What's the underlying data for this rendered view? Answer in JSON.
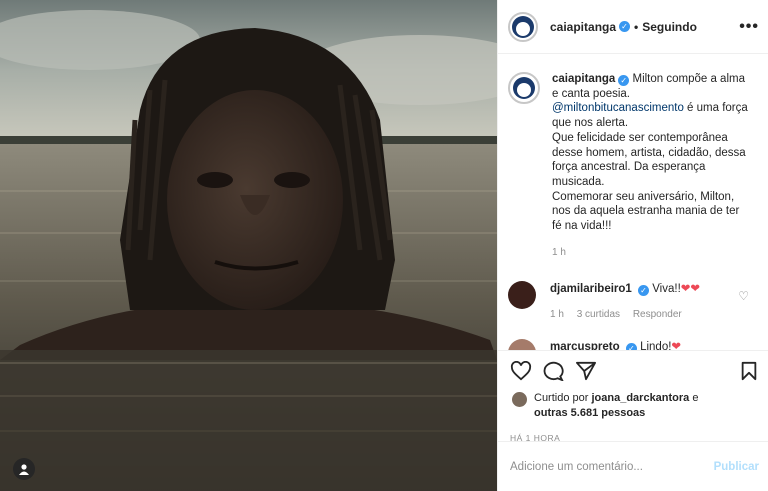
{
  "post": {
    "username": "caiapitanga",
    "follow_state": "Seguindo",
    "dot": "•",
    "more": "•••"
  },
  "caption": {
    "username": "caiapitanga",
    "line1": "Milton compõe a alma e canta poesia.",
    "mention": "@miltonbitucanascimento",
    "line2": " é uma força que nos alerta.",
    "line3": "Que felicidade ser contemporânea desse homem, artista, cidadão, dessa força ancestral. Da esperança musicada.",
    "line4": "Comemorar seu aniversário, Milton, nos da aquela estranha mania de ter fé na vida!!!",
    "time": "1 h"
  },
  "comments": [
    {
      "username": "djamilaribeiro1",
      "text": "Viva!!",
      "time": "1 h",
      "likes": "3 curtidas",
      "reply": "Responder",
      "avatar_color": "#3a1f1a"
    },
    {
      "username": "marcuspreto",
      "text": "Lindo!",
      "avatar_color": "#a57b6a"
    }
  ],
  "likes": {
    "prefix": "Curtido por ",
    "user": "joana_darckantora",
    "mid": " e",
    "others": "outras 5.681 pessoas"
  },
  "ago": "HÁ 1 HORA",
  "add_comment": {
    "placeholder": "Adicione um comentário...",
    "publish": "Publicar"
  },
  "icons": {
    "like": "heart-icon",
    "comment": "comment-icon",
    "share": "share-icon",
    "save": "bookmark-icon",
    "tag": "user-tag-icon",
    "verified": "verified-icon"
  },
  "colors": {
    "verified": "#3897f0",
    "link": "#00376b",
    "publish_disabled": "#b2dffc",
    "heart": "#ed4956"
  }
}
